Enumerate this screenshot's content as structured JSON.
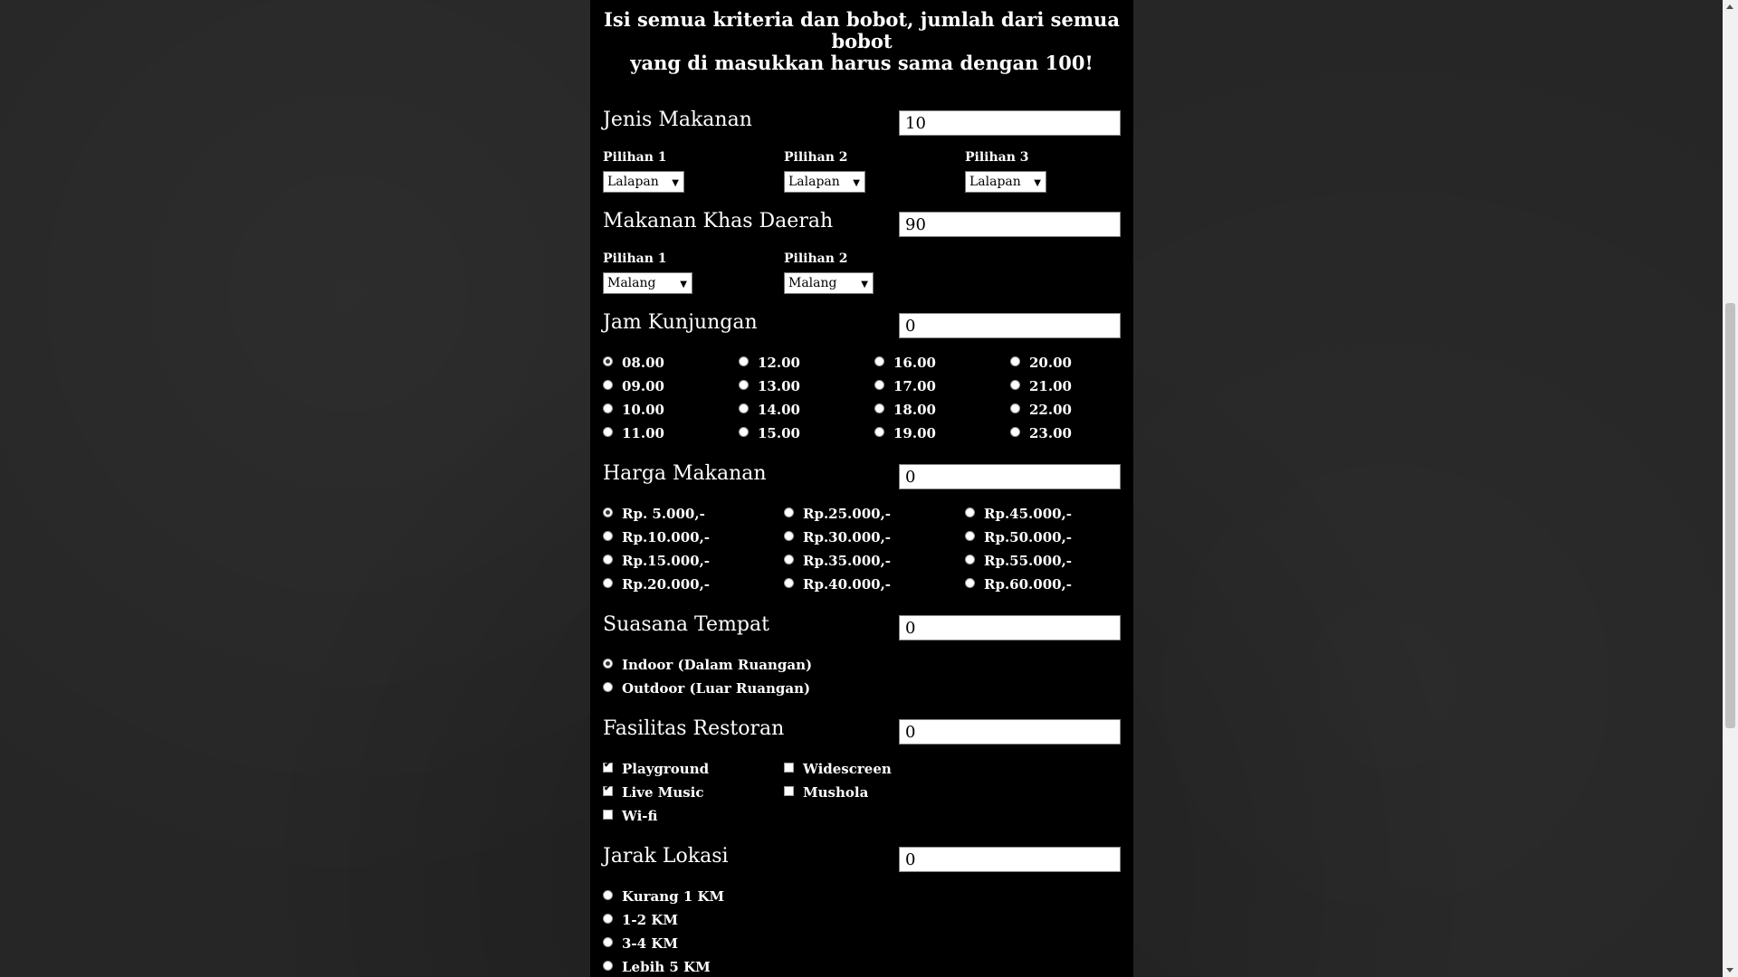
{
  "intro": {
    "line1": "Isi semua kriteria dan bobot, jumlah dari semua bobot",
    "line2": "yang di masukkan harus sama dengan 100!"
  },
  "jenis": {
    "title": "Jenis Makanan",
    "weight": "10",
    "options": [
      {
        "label": "Pilihan 1",
        "value": "Lalapan"
      },
      {
        "label": "Pilihan 2",
        "value": "Lalapan"
      },
      {
        "label": "Pilihan 3",
        "value": "Lalapan"
      }
    ]
  },
  "khas": {
    "title": "Makanan Khas Daerah",
    "weight": "90",
    "options": [
      {
        "label": "Pilihan 1",
        "value": "Malang"
      },
      {
        "label": "Pilihan 2",
        "value": "Malang"
      }
    ]
  },
  "jam": {
    "title": "Jam Kunjungan",
    "weight": "0",
    "times": [
      "08.00",
      "09.00",
      "10.00",
      "11.00",
      "12.00",
      "13.00",
      "14.00",
      "15.00",
      "16.00",
      "17.00",
      "18.00",
      "19.00",
      "20.00",
      "21.00",
      "22.00",
      "23.00"
    ],
    "selected": "08.00"
  },
  "harga": {
    "title": "Harga Makanan",
    "weight": "0",
    "prices": [
      "Rp. 5.000,-",
      "Rp.10.000,-",
      "Rp.15.000,-",
      "Rp.20.000,-",
      "Rp.25.000,-",
      "Rp.30.000,-",
      "Rp.35.000,-",
      "Rp.40.000,-",
      "Rp.45.000,-",
      "Rp.50.000,-",
      "Rp.55.000,-",
      "Rp.60.000,-"
    ],
    "selected": "Rp. 5.000,-"
  },
  "suasana": {
    "title": "Suasana Tempat",
    "weight": "0",
    "options": [
      "Indoor (Dalam Ruangan)",
      "Outdoor (Luar Ruangan)"
    ],
    "selected": "Indoor (Dalam Ruangan)"
  },
  "fasilitas": {
    "title": "Fasilitas Restoran",
    "weight": "0",
    "options": [
      {
        "label": "Playground",
        "checked": true
      },
      {
        "label": "Live Music",
        "checked": true
      },
      {
        "label": "Wi-fi",
        "checked": false
      },
      {
        "label": "Widescreen",
        "checked": false
      },
      {
        "label": "Mushola",
        "checked": false
      }
    ]
  },
  "jarak": {
    "title": "Jarak Lokasi",
    "weight": "0",
    "options": [
      "Kurang 1 KM",
      "1-2 KM",
      "3-4 KM",
      "Lebih 5 KM"
    ]
  }
}
